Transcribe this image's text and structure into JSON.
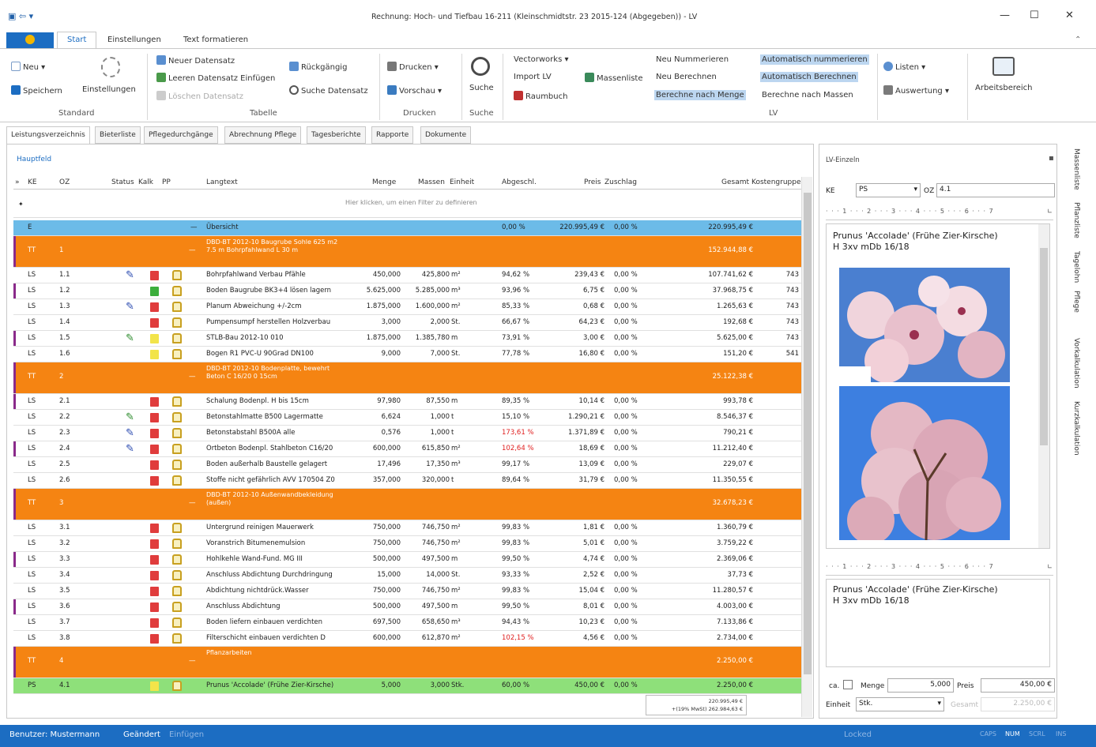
{
  "window": {
    "title": "Rechnung: Hoch- und Tiefbau 16-211 (Kleinschmidtstr. 23 2015-124 (Abgegeben)) - LV",
    "minimize": "—",
    "maximize": "☐",
    "close": "✕"
  },
  "ribbon_tabs": [
    "Start",
    "Einstellungen",
    "Text formatieren"
  ],
  "ribbon": {
    "neu": "Neu",
    "speichern": "Speichern",
    "einstellungen": "Einstellungen",
    "standard": "Standard",
    "neuer_datensatz": "Neuer Datensatz",
    "leeren_datensatz": "Leeren Datensatz Einfügen",
    "loeschen": "Löschen Datensatz",
    "rueckgaengig": "Rückgängig",
    "suche_datensatz": "Suche Datensatz",
    "tabelle": "Tabelle",
    "drucken": "Drucken",
    "vorschau": "Vorschau",
    "drucken_group": "Drucken",
    "suche": "Suche",
    "suche_group": "Suche",
    "vectorworks": "Vectorworks",
    "import_lv": "Import LV",
    "raumbuch": "Raumbuch",
    "massenliste": "Massenliste",
    "neu_nummerieren": "Neu Nummerieren",
    "neu_berechnen": "Neu Berechnen",
    "berechne_menge": "Berechne nach Menge",
    "auto_nummerieren": "Automatisch nummerieren",
    "auto_berechnen": "Automatisch Berechnen",
    "berechne_massen": "Berechne nach Massen",
    "lv_group": "LV",
    "listen": "Listen",
    "auswertung": "Auswertung",
    "arbeitsbereich": "Arbeitsbereich"
  },
  "doc_tabs": [
    "Leistungsverzeichnis",
    "Bieterliste",
    "Pflegedurchgänge",
    "Abrechnung Pflege",
    "Tagesberichte",
    "Rapporte",
    "Dokumente"
  ],
  "grid": {
    "hauptfeld": "Hauptfeld",
    "headers": {
      "ke": "KE",
      "oz": "OZ",
      "status": "Status",
      "kalk": "Kalk",
      "pp": "PP",
      "langtext": "Langtext",
      "menge": "Menge",
      "massen": "Massen",
      "einheit": "Einheit",
      "abgeschl": "Abgeschl.",
      "preis": "Preis",
      "zuschlag": "Zuschlag",
      "gesamt": "Gesamt",
      "kostengruppe": "Kostengruppe"
    },
    "filter_hint": "Hier klicken, um einen Filter zu definieren",
    "rows": [
      {
        "type": "blue",
        "ke": "E",
        "oz": "",
        "langtext": "Übersicht",
        "menge": "",
        "massen": "",
        "einheit": "",
        "abg": "0,00 %",
        "preis": "220.995,49 €",
        "zuschlag": "0,00 %",
        "gesamt": "220.995,49 €",
        "kg": ""
      },
      {
        "type": "orange",
        "ke": "TT",
        "oz": "1",
        "langtext": "DBD-BT 2012-10 Baugrube Sohle 625 m2 7.5 m Bohrpfahlwand L 30 m",
        "gesamt": "152.944,88 €"
      },
      {
        "type": "item",
        "ke": "LS",
        "oz": "1.1",
        "pin": "blue",
        "kalk": "red",
        "langtext": "Bohrpfahlwand Verbau Pfähle",
        "menge": "450,000",
        "massen": "425,800",
        "einheit": "m²",
        "abg": "94,62 %",
        "preis": "239,43 €",
        "zuschlag": "0,00 %",
        "gesamt": "107.741,62 €",
        "kg": "743"
      },
      {
        "type": "item",
        "ke": "LS",
        "oz": "1.2",
        "pin": "",
        "kalk": "green",
        "langtext": "Boden Baugrube BK3+4 lösen lagern",
        "menge": "5.625,000",
        "massen": "5.285,000",
        "einheit": "m³",
        "abg": "93,96 %",
        "preis": "6,75 €",
        "zuschlag": "0,00 %",
        "gesamt": "37.968,75 €",
        "kg": "743"
      },
      {
        "type": "item",
        "ke": "LS",
        "oz": "1.3",
        "pin": "blue",
        "kalk": "red",
        "langtext": "Planum Abweichung +/-2cm",
        "menge": "1.875,000",
        "massen": "1.600,000",
        "einheit": "m²",
        "abg": "85,33 %",
        "preis": "0,68 €",
        "zuschlag": "0,00 %",
        "gesamt": "1.265,63 €",
        "kg": "743"
      },
      {
        "type": "item",
        "ke": "LS",
        "oz": "1.4",
        "pin": "",
        "kalk": "red",
        "langtext": "Pumpensumpf herstellen Holzverbau",
        "menge": "3,000",
        "massen": "2,000",
        "einheit": "St.",
        "abg": "66,67 %",
        "preis": "64,23 €",
        "zuschlag": "0,00 %",
        "gesamt": "192,68 €",
        "kg": "743"
      },
      {
        "type": "item",
        "ke": "LS",
        "oz": "1.5",
        "pin": "green",
        "kalk": "yellow",
        "langtext": "STLB-Bau 2012-10 010",
        "menge": "1.875,000",
        "massen": "1.385,780",
        "einheit": "m",
        "abg": "73,91 %",
        "preis": "3,00 €",
        "zuschlag": "0,00 %",
        "gesamt": "5.625,00 €",
        "kg": "743"
      },
      {
        "type": "item",
        "ke": "LS",
        "oz": "1.6",
        "pin": "",
        "kalk": "yellow",
        "langtext": "Bogen R1 PVC-U 90Grad DN100",
        "menge": "9,000",
        "massen": "7,000",
        "einheit": "St.",
        "abg": "77,78 %",
        "preis": "16,80 €",
        "zuschlag": "0,00 %",
        "gesamt": "151,20 €",
        "kg": "541"
      },
      {
        "type": "orange",
        "ke": "TT",
        "oz": "2",
        "langtext": "DBD-BT 2012-10 Bodenplatte, bewehrt Beton C 16/20 0 15cm",
        "gesamt": "25.122,38 €"
      },
      {
        "type": "item",
        "ke": "LS",
        "oz": "2.1",
        "pin": "",
        "kalk": "red",
        "langtext": "Schalung Bodenpl. H bis 15cm",
        "menge": "97,980",
        "massen": "87,550",
        "einheit": "m",
        "abg": "89,35 %",
        "preis": "10,14 €",
        "zuschlag": "0,00 %",
        "gesamt": "993,78 €",
        "kg": ""
      },
      {
        "type": "item",
        "ke": "LS",
        "oz": "2.2",
        "pin": "green",
        "kalk": "red",
        "langtext": "Betonstahlmatte B500 Lagermatte",
        "menge": "6,624",
        "massen": "1,000",
        "einheit": "t",
        "abg": "15,10 %",
        "preis": "1.290,21 €",
        "zuschlag": "0,00 %",
        "gesamt": "8.546,37 €",
        "kg": ""
      },
      {
        "type": "item",
        "ke": "LS",
        "oz": "2.3",
        "pin": "blue",
        "kalk": "red",
        "langtext": "Betonstabstahl B500A alle",
        "menge": "0,576",
        "massen": "1,000",
        "einheit": "t",
        "abg": "173,61 %",
        "abgred": true,
        "preis": "1.371,89 €",
        "zuschlag": "0,00 %",
        "gesamt": "790,21 €",
        "kg": ""
      },
      {
        "type": "item",
        "ke": "LS",
        "oz": "2.4",
        "pin": "blue",
        "kalk": "red",
        "langtext": "Ortbeton Bodenpl. Stahlbeton C16/20",
        "menge": "600,000",
        "massen": "615,850",
        "einheit": "m²",
        "abg": "102,64 %",
        "abgred": true,
        "preis": "18,69 €",
        "zuschlag": "0,00 %",
        "gesamt": "11.212,40 €",
        "kg": ""
      },
      {
        "type": "item",
        "ke": "LS",
        "oz": "2.5",
        "pin": "",
        "kalk": "red",
        "langtext": "Boden außerhalb Baustelle gelagert",
        "menge": "17,496",
        "massen": "17,350",
        "einheit": "m³",
        "abg": "99,17 %",
        "preis": "13,09 €",
        "zuschlag": "0,00 %",
        "gesamt": "229,07 €",
        "kg": ""
      },
      {
        "type": "item",
        "ke": "LS",
        "oz": "2.6",
        "pin": "",
        "kalk": "red",
        "langtext": "Stoffe nicht gefährlich AVV 170504 Z0",
        "menge": "357,000",
        "massen": "320,000",
        "einheit": "t",
        "abg": "89,64 %",
        "preis": "31,79 €",
        "zuschlag": "0,00 %",
        "gesamt": "11.350,55 €",
        "kg": ""
      },
      {
        "type": "orange",
        "ke": "TT",
        "oz": "3",
        "langtext": "DBD-BT 2012-10 Außenwandbekleidung (außen)",
        "gesamt": "32.678,23 €"
      },
      {
        "type": "item",
        "ke": "LS",
        "oz": "3.1",
        "pin": "",
        "kalk": "red",
        "langtext": "Untergrund reinigen Mauerwerk",
        "menge": "750,000",
        "massen": "746,750",
        "einheit": "m²",
        "abg": "99,83 %",
        "preis": "1,81 €",
        "zuschlag": "0,00 %",
        "gesamt": "1.360,79 €",
        "kg": ""
      },
      {
        "type": "item",
        "ke": "LS",
        "oz": "3.2",
        "pin": "",
        "kalk": "red",
        "langtext": "Voranstrich Bitumenemulsion",
        "menge": "750,000",
        "massen": "746,750",
        "einheit": "m²",
        "abg": "99,83 %",
        "preis": "5,01 €",
        "zuschlag": "0,00 %",
        "gesamt": "3.759,22 €",
        "kg": ""
      },
      {
        "type": "item",
        "ke": "LS",
        "oz": "3.3",
        "pin": "",
        "kalk": "red",
        "langtext": "Hohlkehle Wand-Fund. MG III",
        "menge": "500,000",
        "massen": "497,500",
        "einheit": "m",
        "abg": "99,50 %",
        "preis": "4,74 €",
        "zuschlag": "0,00 %",
        "gesamt": "2.369,06 €",
        "kg": ""
      },
      {
        "type": "item",
        "ke": "LS",
        "oz": "3.4",
        "pin": "",
        "kalk": "red",
        "langtext": "Anschluss Abdichtung Durchdringung",
        "menge": "15,000",
        "massen": "14,000",
        "einheit": "St.",
        "abg": "93,33 %",
        "preis": "2,52 €",
        "zuschlag": "0,00 %",
        "gesamt": "37,73 €",
        "kg": ""
      },
      {
        "type": "item",
        "ke": "LS",
        "oz": "3.5",
        "pin": "",
        "kalk": "red",
        "langtext": "Abdichtung nichtdrück.Wasser",
        "menge": "750,000",
        "massen": "746,750",
        "einheit": "m²",
        "abg": "99,83 %",
        "preis": "15,04 €",
        "zuschlag": "0,00 %",
        "gesamt": "11.280,57 €",
        "kg": ""
      },
      {
        "type": "item",
        "ke": "LS",
        "oz": "3.6",
        "pin": "",
        "kalk": "red",
        "langtext": "Anschluss Abdichtung",
        "menge": "500,000",
        "massen": "497,500",
        "einheit": "m",
        "abg": "99,50 %",
        "preis": "8,01 €",
        "zuschlag": "0,00 %",
        "gesamt": "4.003,00 €",
        "kg": ""
      },
      {
        "type": "item",
        "ke": "LS",
        "oz": "3.7",
        "pin": "",
        "kalk": "red",
        "langtext": "Boden liefern einbauen verdichten",
        "menge": "697,500",
        "massen": "658,650",
        "einheit": "m³",
        "abg": "94,43 %",
        "preis": "10,23 €",
        "zuschlag": "0,00 %",
        "gesamt": "7.133,86 €",
        "kg": ""
      },
      {
        "type": "item",
        "ke": "LS",
        "oz": "3.8",
        "pin": "",
        "kalk": "red",
        "langtext": "Filterschicht einbauen verdichten D",
        "menge": "600,000",
        "massen": "612,870",
        "einheit": "m²",
        "abg": "102,15 %",
        "abgred": true,
        "preis": "4,56 €",
        "zuschlag": "0,00 %",
        "gesamt": "2.734,00 €",
        "kg": ""
      },
      {
        "type": "orange",
        "ke": "TT",
        "oz": "4",
        "langtext": "Pflanzarbeiten",
        "gesamt": "2.250,00 €"
      },
      {
        "type": "green",
        "ke": "PS",
        "oz": "4.1",
        "pin": "",
        "kalk": "yellow",
        "langtext": "Prunus 'Accolade' (Frühe Zier-Kirsche)",
        "menge": "5,000",
        "massen": "3,000",
        "einheit": "Stk.",
        "abg": "60,00 %",
        "preis": "450,00 €",
        "zuschlag": "0,00 %",
        "gesamt": "2.250,00 €",
        "kg": ""
      }
    ],
    "sum_line1": "220.995,49 €",
    "sum_line2": "+(19% MwSt) 262.984,63 €"
  },
  "right_panel": {
    "title": "LV-Einzeln",
    "ke_label": "KE",
    "ke_value": "PS",
    "oz_label": "OZ",
    "oz_value": "4.1",
    "ruler": "· · · 1 · · · 2 · · · 3 · · · 4 · · · 5 · · · 6 · · · 7",
    "plant_line1": "Prunus 'Accolade' (Frühe Zier-Kirsche)",
    "plant_line2": "H 3xv mDb 16/18",
    "ca_label": "ca.",
    "menge_label": "Menge",
    "menge_value": "5,000",
    "preis_label": "Preis",
    "preis_value": "450,00 €",
    "einheit_label": "Einheit",
    "einheit_value": "Stk.",
    "gesamt_label": "Gesamt",
    "gesamt_value": "2.250,00 €"
  },
  "side_tabs": [
    "Massenliste",
    "Pflanzliste",
    "Tagelohn",
    "Pflege",
    "Vorkalkulation",
    "Kurzkalkulation"
  ],
  "status": {
    "benutzer": "Benutzer: Mustermann",
    "geaendert": "Geändert",
    "einfuegen": "Einfügen",
    "locked": "Locked",
    "caps": "CAPS",
    "num": "NUM",
    "scrl": "SCRL",
    "ins": "INS"
  },
  "colors": {
    "accent": "#1c6dc2",
    "orange": "#f58412",
    "blue_row": "#6cbbe8",
    "green_row": "#8ee07a",
    "kalk_red": "#e03c3c",
    "kalk_green": "#3cae3c",
    "kalk_yellow": "#f2e44a"
  }
}
